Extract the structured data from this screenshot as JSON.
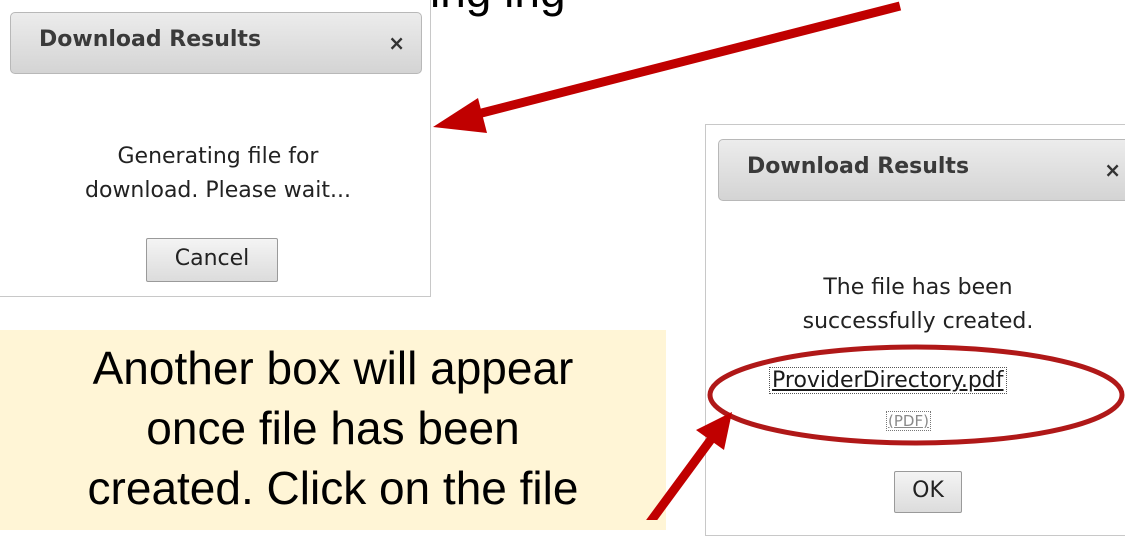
{
  "caption_fragment": "ing       ing",
  "dialog_generating": {
    "title": "Download Results",
    "close_glyph": "×",
    "message_line1": "Generating file for",
    "message_line2": "download. Please wait...",
    "cancel_label": "Cancel"
  },
  "dialog_created": {
    "title": "Download Results",
    "close_glyph": "×",
    "message_line1": "The file has been",
    "message_line2": "successfully created.",
    "file_name": "ProviderDirectory.pdf",
    "file_type": "(PDF)",
    "ok_label": "OK"
  },
  "callout": {
    "line1": "Another box will appear",
    "line2": "once file has been",
    "line3": "created. Click on the file"
  },
  "colors": {
    "arrow": "#c00000",
    "highlight_ellipse": "#b01818",
    "callout_background": "#fff5d6"
  }
}
